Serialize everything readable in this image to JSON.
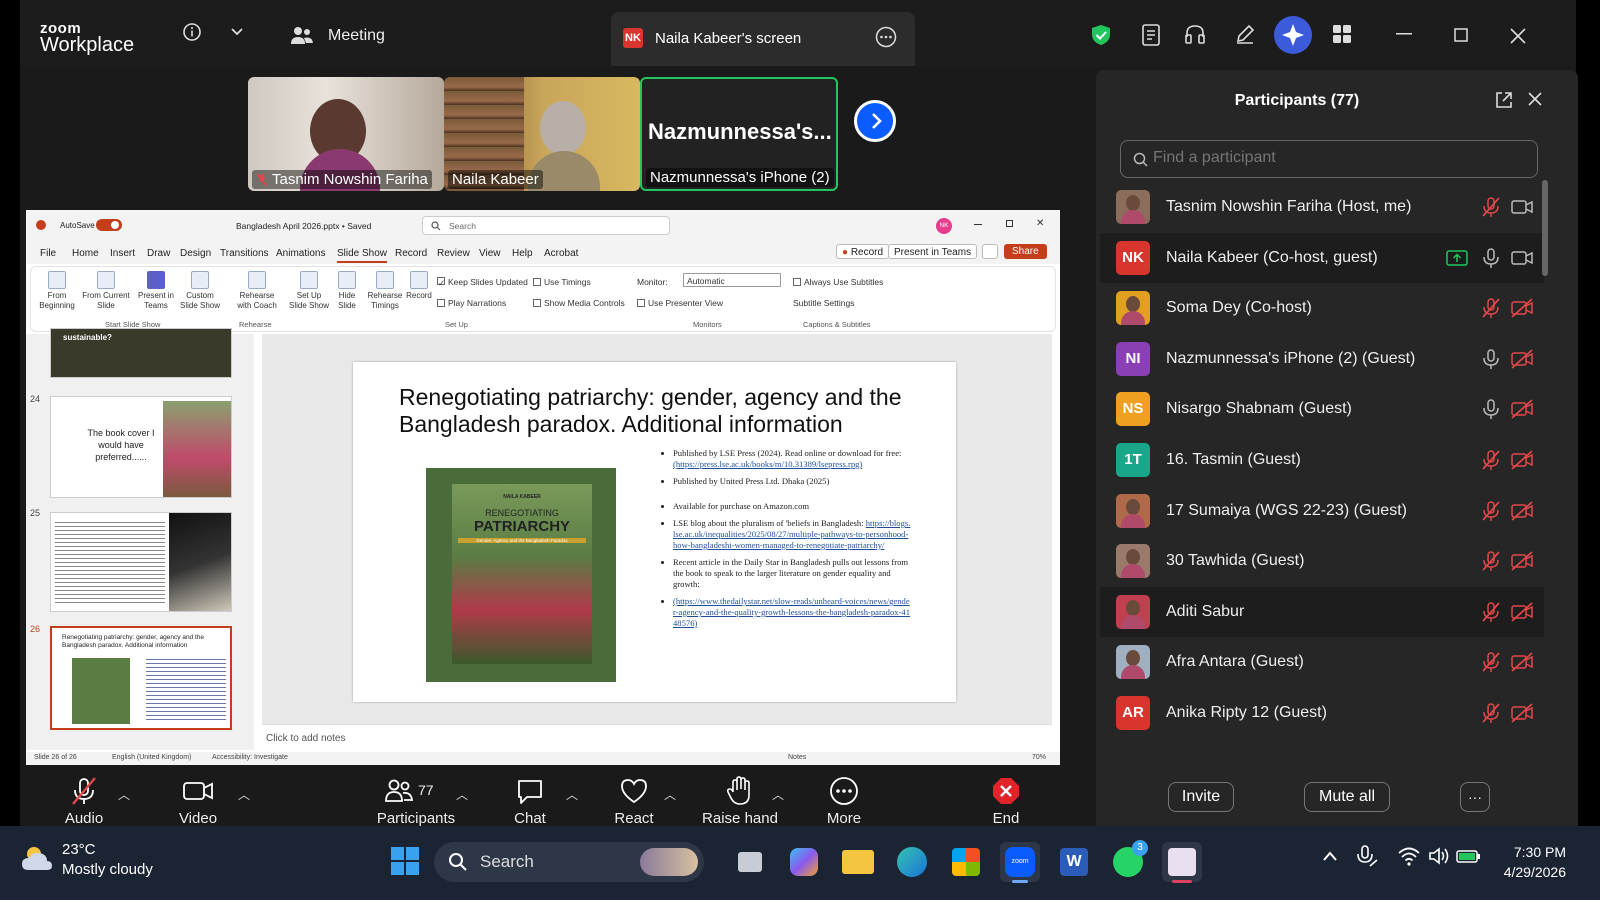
{
  "zoom": {
    "logo_top": "zoom",
    "logo_bottom": "Workplace",
    "meeting_label": "Meeting",
    "screen_badge": "NK",
    "screen_title": "Naila Kabeer's screen"
  },
  "video_tiles": [
    {
      "name": "Tasnim Nowshin Fariha"
    },
    {
      "name": "Naila Kabeer"
    },
    {
      "big_name": "Nazmunnessa's...",
      "name": "Nazmunnessa's iPhone (2)"
    }
  ],
  "ppt": {
    "autosave": "AutoSave",
    "file_title": "Bangladesh April  2026.pptx • Saved",
    "search_placeholder": "Search",
    "user_initials": "NK",
    "tabs": [
      "File",
      "Home",
      "Insert",
      "Draw",
      "Design",
      "Transitions",
      "Animations",
      "Slide Show",
      "Record",
      "Review",
      "View",
      "Help",
      "Acrobat"
    ],
    "record_btn": "Record",
    "present_teams": "Present in Teams",
    "share_btn": "Share",
    "ribbon": {
      "from_beginning": "From Beginning",
      "from_current": "From Current Slide",
      "present_teams": "Present in Teams",
      "custom_show": "Custom Slide Show",
      "group_start": "Start Slide Show",
      "rehearse_coach": "Rehearse with Coach",
      "group_rehearse": "Rehearse",
      "setup_show": "Set Up Slide Show",
      "hide_slide": "Hide Slide",
      "rehearse_timings": "Rehearse Timings",
      "record": "Record",
      "keep_updated": "Keep Slides Updated",
      "use_timings": "Use Timings",
      "play_narrations": "Play Narrations",
      "show_media": "Show Media Controls",
      "group_setup": "Set Up",
      "monitor_label": "Monitor:",
      "monitor_value": "Automatic",
      "presenter_view": "Use Presenter View",
      "group_monitors": "Monitors",
      "always_subtitles": "Always Use Subtitles",
      "subtitle_settings": "Subtitle Settings",
      "group_captions": "Captions & Subtitles"
    },
    "thumbs": {
      "t23_text": "sustainable?",
      "t24_num": "24",
      "t24_text": "The book cover I would have preferred......",
      "t25_num": "25",
      "t26_num": "26",
      "t26_text": "Renegotiating patriarchy: gender, agency and the Bangladesh paradox. Additional information"
    },
    "slide": {
      "title": "Renegotiating patriarchy: gender, agency and the Bangladesh paradox. Additional information",
      "cover_author": "NAILA KABEER",
      "cover_title1": "RENEGOTIATING",
      "cover_title2": "PATRIARCHY",
      "cover_sub": "Gender, Agency and the Bangladesh Paradox",
      "b1": "Published by LSE Press (2024). Read online or download for free:",
      "b1_link": "(https://press.lse.ac.uk/books/m/10.31389/lsepress.rpg)",
      "b2": "Published by United Press Ltd. Dhaka (2025)",
      "b3": "Available for purchase on Amazon.com",
      "b4": "LSE blog about the pluralism of 'beliefs in Bangladesh:",
      "b4_link": "https://blogs.lse.ac.uk/inequalities/2025/08/27/multiple-pathways-to-personhood-how-bangladeshi-women-managed-to-renegotiate-patriarchy/",
      "b5": "Recent article in the Daily Star in Bangladesh pulls out lessons from the book to speak to the larger literature on gender equality and growth:",
      "b6_link": "(https://www.thedailystar.net/slow-reads/unheard-voices/news/gender-agency-and-the-quality-growth-lessons-the-bangladesh-paradox-4148576)"
    },
    "notes_placeholder": "Click to add notes",
    "status": {
      "slide_count": "Slide 26 of 26",
      "language": "English (United Kingdom)",
      "accessibility": "Accessibility: Investigate",
      "notes": "Notes",
      "zoom": "70%"
    }
  },
  "panel": {
    "title": "Participants (77)",
    "search_placeholder": "Find a participant",
    "participants": [
      {
        "name": "Tasnim Nowshin Fariha (Host, me)",
        "initials": "",
        "color": "#8a6d5a",
        "mic": "muted",
        "video": "on",
        "share": false
      },
      {
        "name": "Naila Kabeer (Co-host, guest)",
        "initials": "NK",
        "color": "#d9352f",
        "mic": "on",
        "video": "on",
        "share": true
      },
      {
        "name": "Soma Dey (Co-host)",
        "initials": "",
        "color": "#e0a020",
        "mic": "muted",
        "video": "off",
        "share": false
      },
      {
        "name": "Nazmunnessa's iPhone (2) (Guest)",
        "initials": "NI",
        "color": "#8b3fb5",
        "mic": "on",
        "video": "off",
        "share": false
      },
      {
        "name": "Nisargo Shabnam (Guest)",
        "initials": "NS",
        "color": "#f0a020",
        "mic": "on",
        "video": "off",
        "share": false
      },
      {
        "name": "16. Tasmin (Guest)",
        "initials": "1T",
        "color": "#19a78a",
        "mic": "muted",
        "video": "off",
        "share": false
      },
      {
        "name": "17 Sumaiya (WGS 22-23) (Guest)",
        "initials": "",
        "color": "#b06a4a",
        "mic": "muted",
        "video": "off",
        "share": false
      },
      {
        "name": "30 Tawhida (Guest)",
        "initials": "",
        "color": "#9a7a6a",
        "mic": "muted",
        "video": "off",
        "share": false
      },
      {
        "name": "Aditi Sabur",
        "initials": "",
        "color": "#c04050",
        "mic": "muted",
        "video": "off",
        "share": false
      },
      {
        "name": "Afra Antara (Guest)",
        "initials": "",
        "color": "#a0b0c0",
        "mic": "muted",
        "video": "off",
        "share": false
      },
      {
        "name": "Anika Ripty 12 (Guest)",
        "initials": "AR",
        "color": "#d9352f",
        "mic": "muted",
        "video": "off",
        "share": false
      }
    ],
    "invite": "Invite",
    "mute_all": "Mute all"
  },
  "controls": {
    "audio": "Audio",
    "video": "Video",
    "participants": "Participants",
    "participant_count": "77",
    "chat": "Chat",
    "react": "React",
    "raise_hand": "Raise hand",
    "more": "More",
    "end": "End"
  },
  "taskbar": {
    "temp": "23°C",
    "weather": "Mostly cloudy",
    "search": "Search",
    "whatsapp_badge": "3",
    "time": "7:30 PM",
    "date": "4/29/2026"
  },
  "colors": {
    "accent_blue": "#0b5cff",
    "muted_red": "#e0484b",
    "active_green": "#22c55e"
  }
}
